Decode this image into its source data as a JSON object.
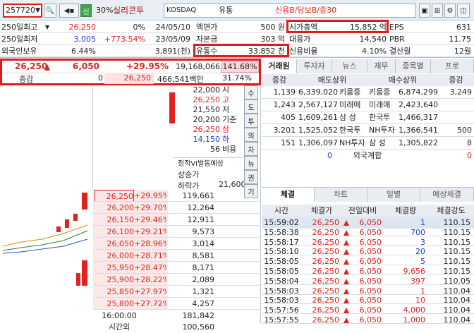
{
  "top": {
    "code": "257720",
    "tag": "신",
    "rate": "30%",
    "name": "실리콘투",
    "market": "KOSDAQ",
    "sector": "유통",
    "credit": "신용B/담보B/증30"
  },
  "info": [
    {
      "l": "250일최고",
      "v1": "26,250",
      "v2": "0%",
      "v3": "24/05/10",
      "k": "액면가",
      "kv": "500 원",
      "k2": "시가총액",
      "k2v": "15,852 억",
      "k3": "EPS",
      "k3v": "631"
    },
    {
      "l": "250일최저",
      "v1": "3,005",
      "v2": "+773.54%",
      "v3": "23/05/09",
      "k": "자본금",
      "kv": "303 억",
      "k2": "대용가",
      "k2v": "14,540",
      "k3": "PBR",
      "k3v": "11.75"
    },
    {
      "l": "외국인보유",
      "v1": "6.44%",
      "v2": "",
      "v3": "3,891(천)",
      "k": "유통수",
      "kv": "33,852 천",
      "k2": "신용비율",
      "k2v": "4.10%",
      "k3": "결산월",
      "k3v": "12월"
    }
  ],
  "quote": {
    "price": "26,250",
    "change": "6,050",
    "pct": "+29.95%",
    "volume": "19,168,066",
    "vpct": "141.68%",
    "label": "증감",
    "z": "0",
    "p2": "26,250",
    "amt": "466,541백만",
    "pct2": "31.74%"
  },
  "priceinfo": [
    [
      "22,000",
      "시"
    ],
    [
      "26,250",
      "고"
    ],
    [
      "21,550",
      "저"
    ],
    [
      "20,200",
      "기준"
    ],
    [
      "26,250",
      "상"
    ],
    [
      "14,150",
      "하"
    ],
    [
      "56",
      "비용"
    ]
  ],
  "vi": {
    "title": "정적VI발동예상",
    "up": "상승가",
    "down": "하락가",
    "downv": "21,600"
  },
  "sidetabs": [
    "수",
    "도",
    "투",
    "외",
    "차",
    "뉴",
    "권",
    "기"
  ],
  "order": [
    {
      "p": "26,250",
      "pc": "+29.95%",
      "q": "119,661",
      "red": true
    },
    {
      "p": "26,200",
      "pc": "+29.70%",
      "q": "12,264"
    },
    {
      "p": "26,150",
      "pc": "+29.46%",
      "q": "12,911"
    },
    {
      "p": "26,100",
      "pc": "+29.21%",
      "q": "9,573"
    },
    {
      "p": "26,050",
      "pc": "+28.96%",
      "q": "3,014"
    },
    {
      "p": "26,000",
      "pc": "+28.71%",
      "q": "8,581"
    },
    {
      "p": "25,950",
      "pc": "+28.47%",
      "q": "8,171"
    },
    {
      "p": "25,900",
      "pc": "+28.22%",
      "q": "2,089"
    },
    {
      "p": "25,850",
      "pc": "+27.97%",
      "q": "1,321"
    },
    {
      "p": "25,800",
      "pc": "+27.72%",
      "q": "4,257"
    }
  ],
  "ordfoot": [
    {
      "a": "16:00:00",
      "b": "181,842"
    },
    {
      "a": "시간외",
      "b": "100,560"
    }
  ],
  "broker": {
    "tabs": [
      "거래원",
      "투자자",
      "뉴스",
      "재무",
      "종목별",
      "프로"
    ],
    "h": [
      "증감",
      "매도상위",
      "매수상위",
      "증감"
    ],
    "rows": [
      {
        "a": "1,139",
        "b": "6,339,020",
        "c": "키움증",
        "d": "키움증",
        "e": "6,874,299",
        "f": "3,249"
      },
      {
        "a": "1,243",
        "b": "2,567,127",
        "c": "미래에",
        "d": "미래에",
        "e": "2,423,640",
        "f": ""
      },
      {
        "a": "405",
        "b": "1,609,261",
        "c": "삼 성",
        "d": "한국투",
        "e": "1,466,317",
        "f": ""
      },
      {
        "a": "3,201",
        "b": "1,525,052",
        "c": "한국투",
        "d": "NH투자",
        "e": "1,366,541",
        "f": "500"
      },
      {
        "a": "151",
        "b": "1,306,097",
        "c": "NH투자",
        "d": "삼 성",
        "e": "1,305,822",
        "f": "8"
      }
    ],
    "foot": {
      "l": "0",
      "m": "외국계합",
      "r": "0"
    }
  },
  "trade": {
    "tabs": [
      "체결",
      "차트",
      "일별",
      "예상체결"
    ],
    "h": [
      "시간",
      "체결가",
      "전일대비",
      "체결량",
      "체결강도"
    ],
    "rows": [
      {
        "t": "15:59:02",
        "p": "26,250",
        "c": "6,050",
        "q": "1",
        "s": "110.15",
        "b": true
      },
      {
        "t": "15:58:38",
        "p": "26,250",
        "c": "6,050",
        "q": "700",
        "s": "110.15",
        "b": true
      },
      {
        "t": "15:58:17",
        "p": "26,250",
        "c": "6,050",
        "q": "3",
        "s": "110.15",
        "b": true
      },
      {
        "t": "15:58:10",
        "p": "26,250",
        "c": "6,050",
        "q": "20",
        "s": "110.15",
        "b": true
      },
      {
        "t": "15:58:05",
        "p": "26,250",
        "c": "6,050",
        "q": "5",
        "s": "110.15",
        "b": true
      },
      {
        "t": "15:58:05",
        "p": "26,250",
        "c": "6,050",
        "q": "9,656",
        "s": "110.15",
        "b": false
      },
      {
        "t": "15:58:04",
        "p": "26,250",
        "c": "6,050",
        "q": "397",
        "s": "110.05",
        "b": false
      },
      {
        "t": "15:58:03",
        "p": "26,250",
        "c": "6,050",
        "q": "1",
        "s": "110.04",
        "b": false
      },
      {
        "t": "15:58:03",
        "p": "26,250",
        "c": "6,050",
        "q": "10",
        "s": "110.04",
        "b": false
      },
      {
        "t": "15:57:56",
        "p": "26,250",
        "c": "6,050",
        "q": "4,000",
        "s": "110.04",
        "b": false
      },
      {
        "t": "15:57:55",
        "p": "26,250",
        "c": "6,050",
        "q": "1,000",
        "s": "110.04",
        "b": false
      }
    ]
  },
  "colors": {
    "up": "#e0231e",
    "down": "#1f3fd2",
    "ask": "#f8d9d9",
    "bid": "#fde8e8",
    "header": "#e9edf2"
  }
}
